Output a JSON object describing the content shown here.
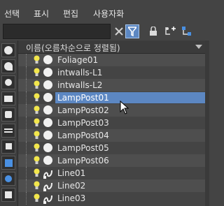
{
  "menu": [
    "선택",
    "표시",
    "편집",
    "사용자화"
  ],
  "header": {
    "column_label": "이름(오름차순으로 정렬됨)"
  },
  "rows": [
    {
      "name": "Foliage01",
      "type": "object"
    },
    {
      "name": "intwalls-L1",
      "type": "object"
    },
    {
      "name": "intwalls-L2",
      "type": "object"
    },
    {
      "name": "LampPost01",
      "type": "object",
      "selected": true
    },
    {
      "name": "LampPost02",
      "type": "object"
    },
    {
      "name": "LampPost03",
      "type": "object"
    },
    {
      "name": "LampPost04",
      "type": "object"
    },
    {
      "name": "LampPost05",
      "type": "object"
    },
    {
      "name": "LampPost06",
      "type": "object"
    },
    {
      "name": "Line01",
      "type": "shape"
    },
    {
      "name": "Line02",
      "type": "shape"
    },
    {
      "name": "Line03",
      "type": "shape"
    }
  ],
  "colors": {
    "background": "#444444",
    "selection": "#5c87c2",
    "text": "#e6e6e6"
  }
}
